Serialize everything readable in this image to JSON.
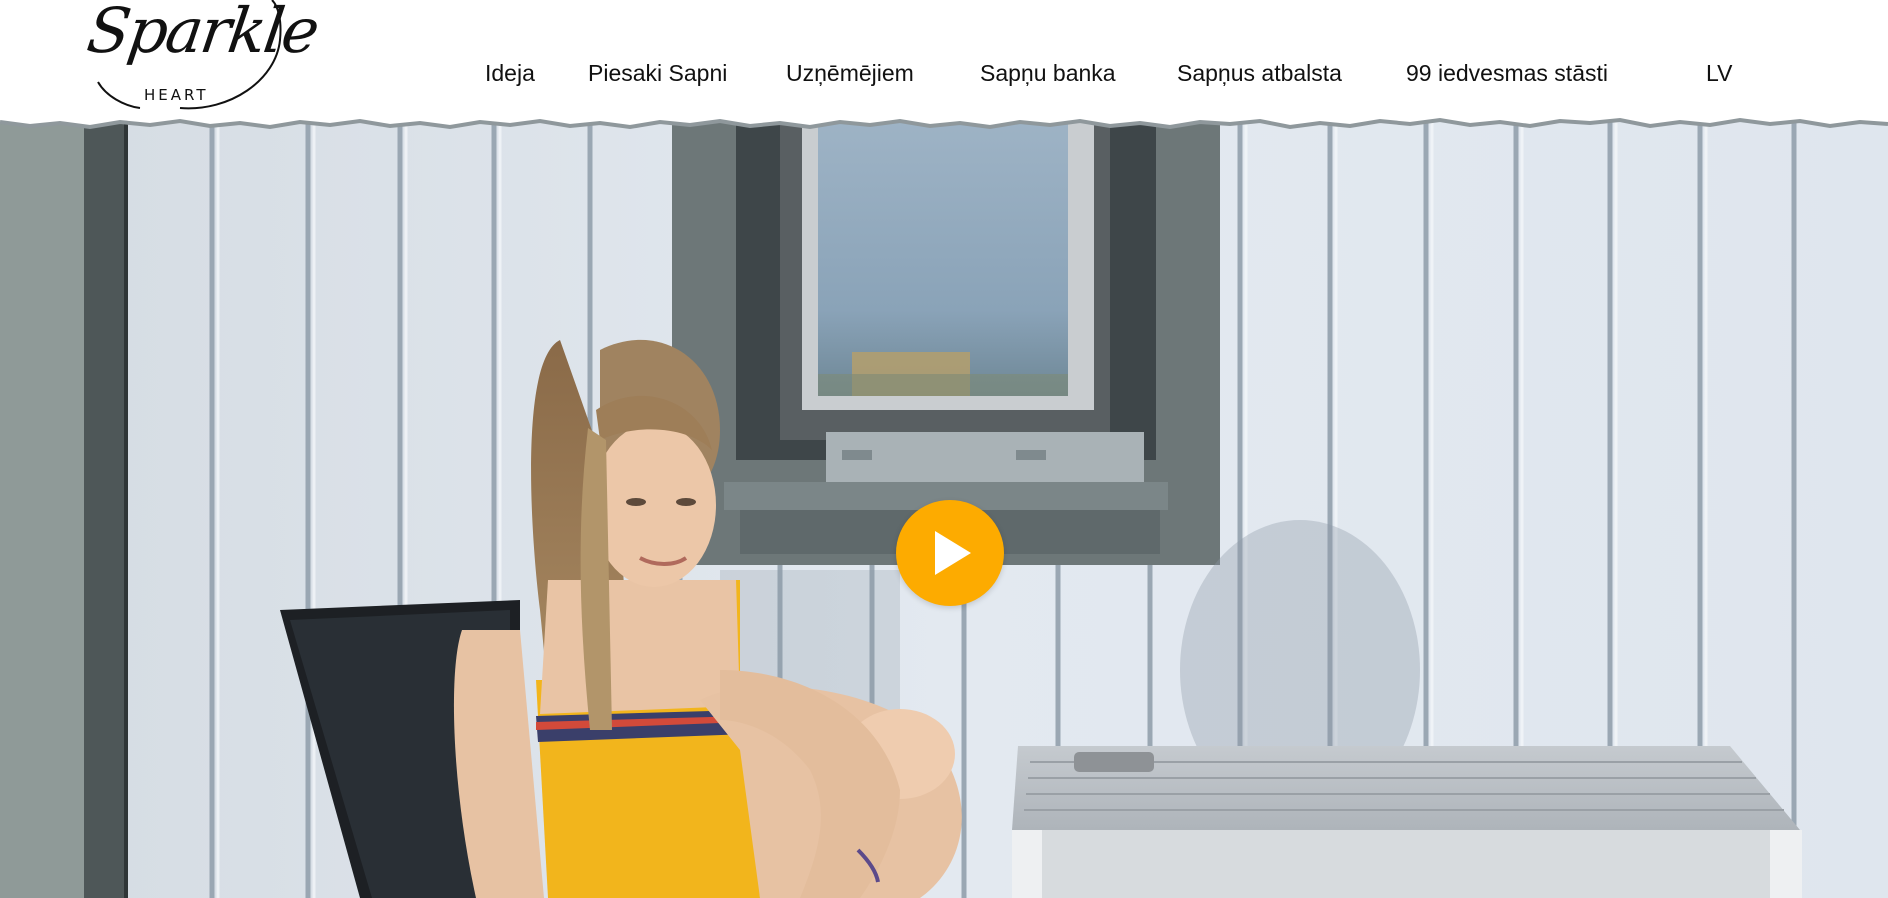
{
  "brand": {
    "logo_text": "Sparkle",
    "logo_subtext": "HEART"
  },
  "nav": {
    "items": [
      {
        "label": "Ideja"
      },
      {
        "label": "Piesaki Sapni"
      },
      {
        "label": "Uzņēmējiem"
      },
      {
        "label": "Sapņu banka"
      },
      {
        "label": "Sapņus atbalsta"
      },
      {
        "label": "99 iedvesmas stāsti"
      }
    ],
    "language": "LV"
  },
  "hero": {
    "media": "video",
    "play_icon": "play-icon",
    "accent_color": "#fdab00"
  }
}
